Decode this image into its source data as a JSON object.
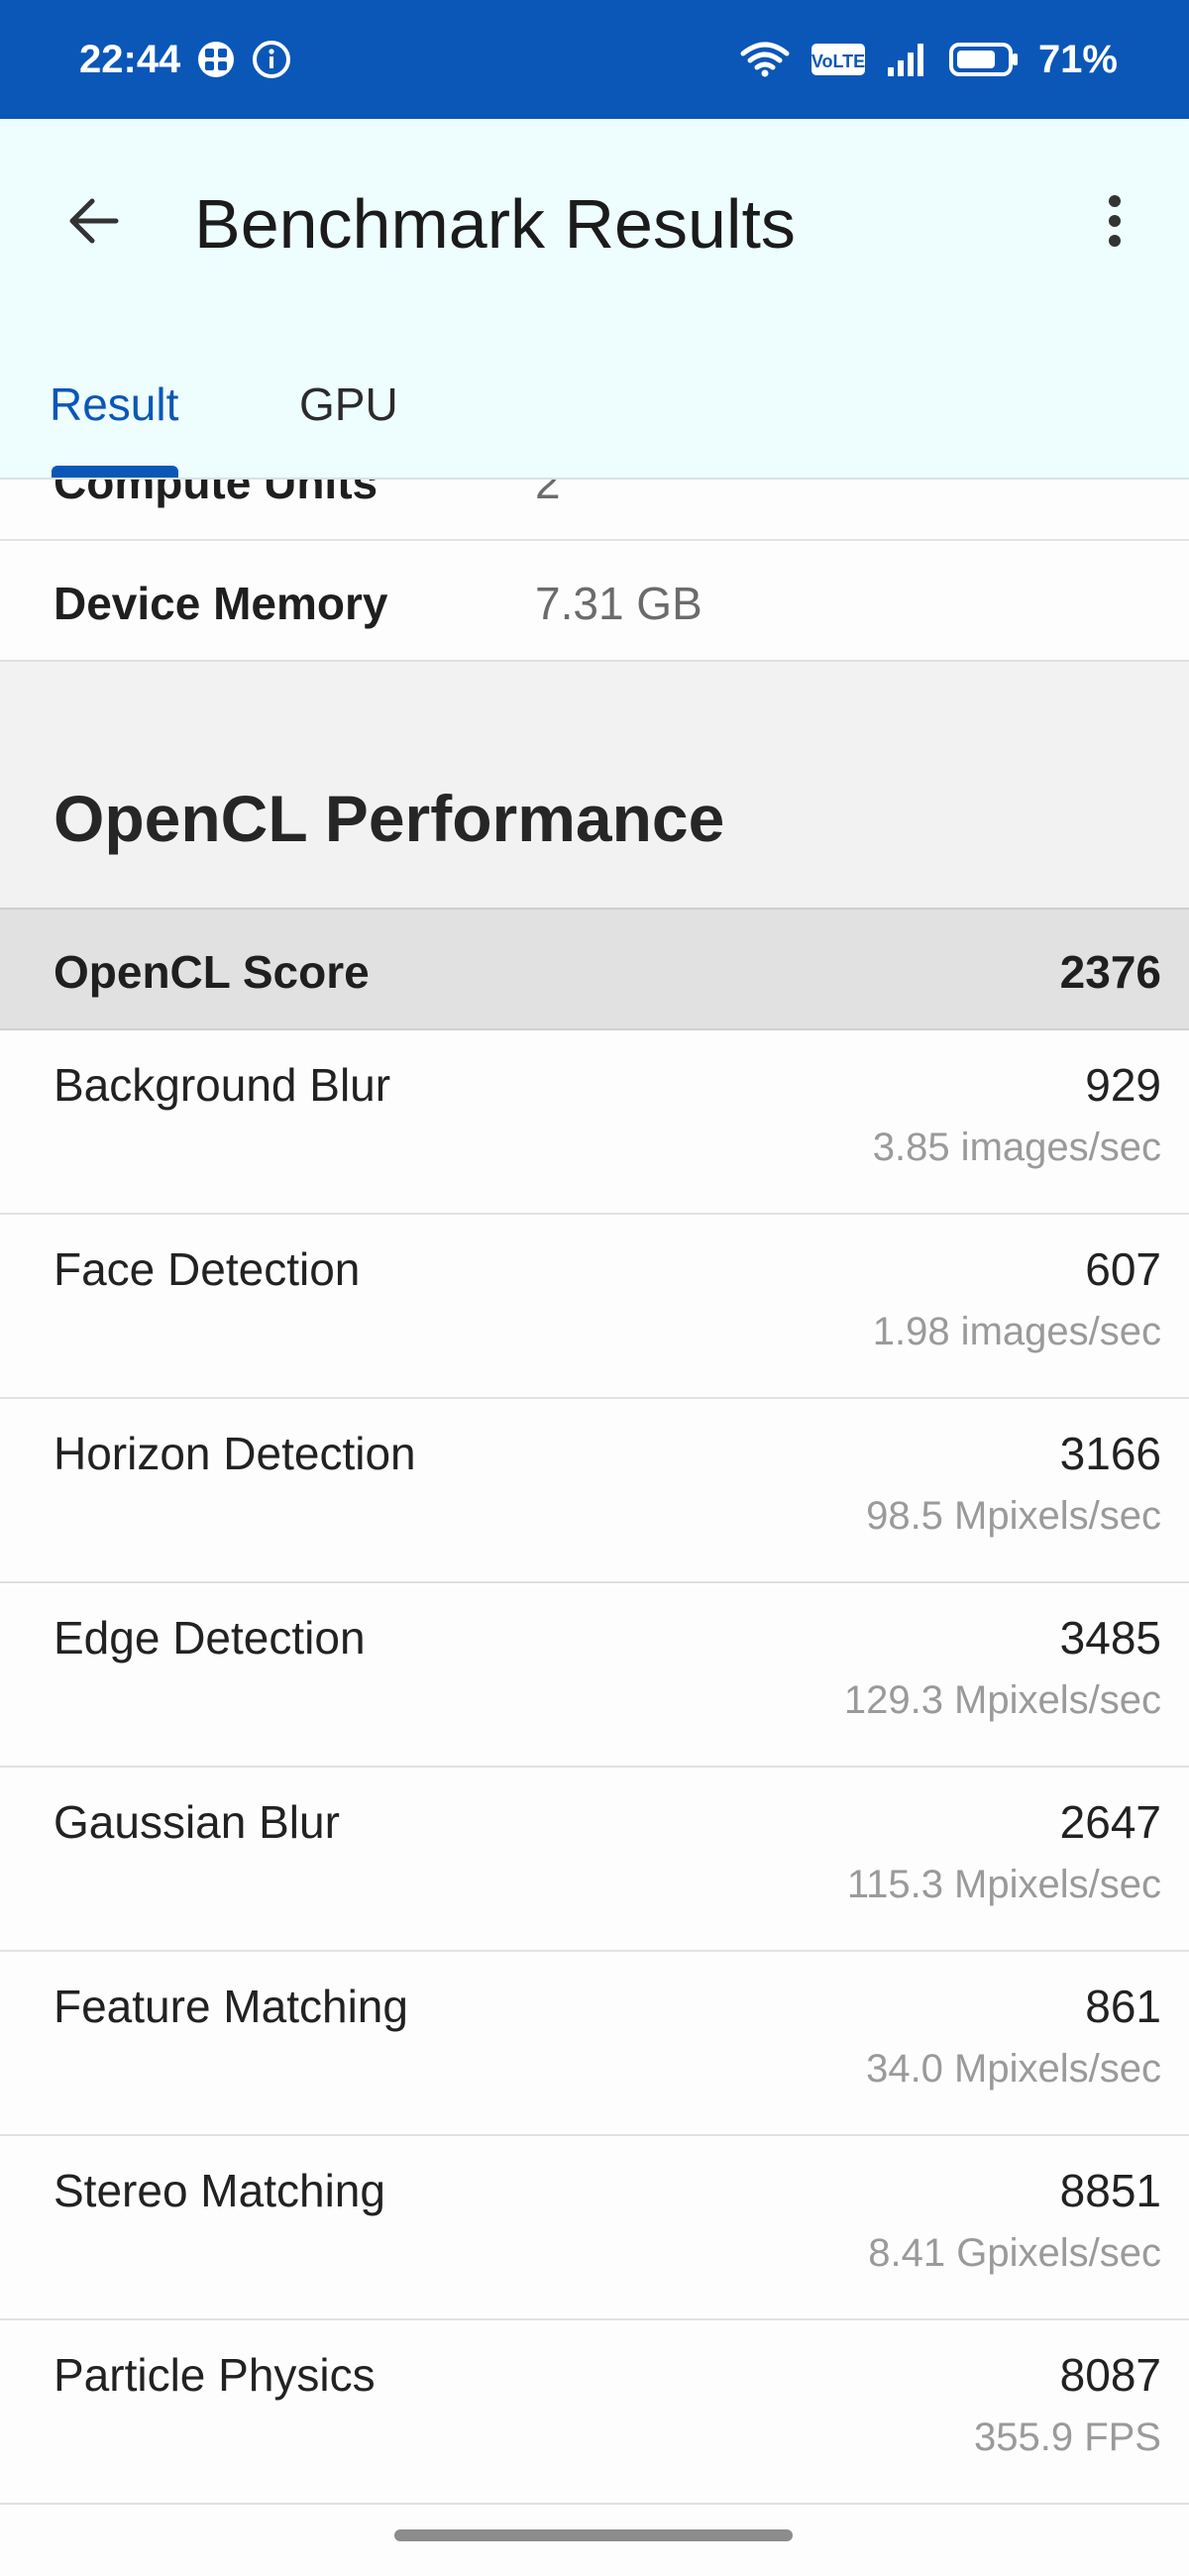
{
  "status_bar": {
    "time": "22:44",
    "battery_percent": "71%",
    "network_badge": "VoLTE",
    "icons": [
      "grid-app-icon",
      "info-icon",
      "wifi-icon",
      "volte-icon",
      "signal-icon",
      "battery-icon"
    ]
  },
  "app_bar": {
    "title": "Benchmark Results",
    "back_icon": "arrow-back-icon",
    "more_icon": "more-vert-icon"
  },
  "tabs": [
    {
      "label": "Result",
      "selected": true
    },
    {
      "label": "GPU",
      "selected": false
    }
  ],
  "device_info": [
    {
      "label": "Compute Units",
      "value": "2"
    },
    {
      "label": "Device Memory",
      "value": "7.31 GB"
    }
  ],
  "section": {
    "title": "OpenCL Performance",
    "score_label": "OpenCL Score",
    "score_value": "2376"
  },
  "results": [
    {
      "name": "Background Blur",
      "score": "929",
      "rate": "3.85 images/sec"
    },
    {
      "name": "Face Detection",
      "score": "607",
      "rate": "1.98 images/sec"
    },
    {
      "name": "Horizon Detection",
      "score": "3166",
      "rate": "98.5 Mpixels/sec"
    },
    {
      "name": "Edge Detection",
      "score": "3485",
      "rate": "129.3 Mpixels/sec"
    },
    {
      "name": "Gaussian Blur",
      "score": "2647",
      "rate": "115.3 Mpixels/sec"
    },
    {
      "name": "Feature Matching",
      "score": "861",
      "rate": "34.0 Mpixels/sec"
    },
    {
      "name": "Stereo Matching",
      "score": "8851",
      "rate": "8.41 Gpixels/sec"
    },
    {
      "name": "Particle Physics",
      "score": "8087",
      "rate": "355.9 FPS"
    }
  ],
  "colors": {
    "status_bar": "#0a57b8",
    "app_bar": "#eefdfe",
    "accent": "#0a57b8",
    "score_row": "#e1e1e1"
  }
}
